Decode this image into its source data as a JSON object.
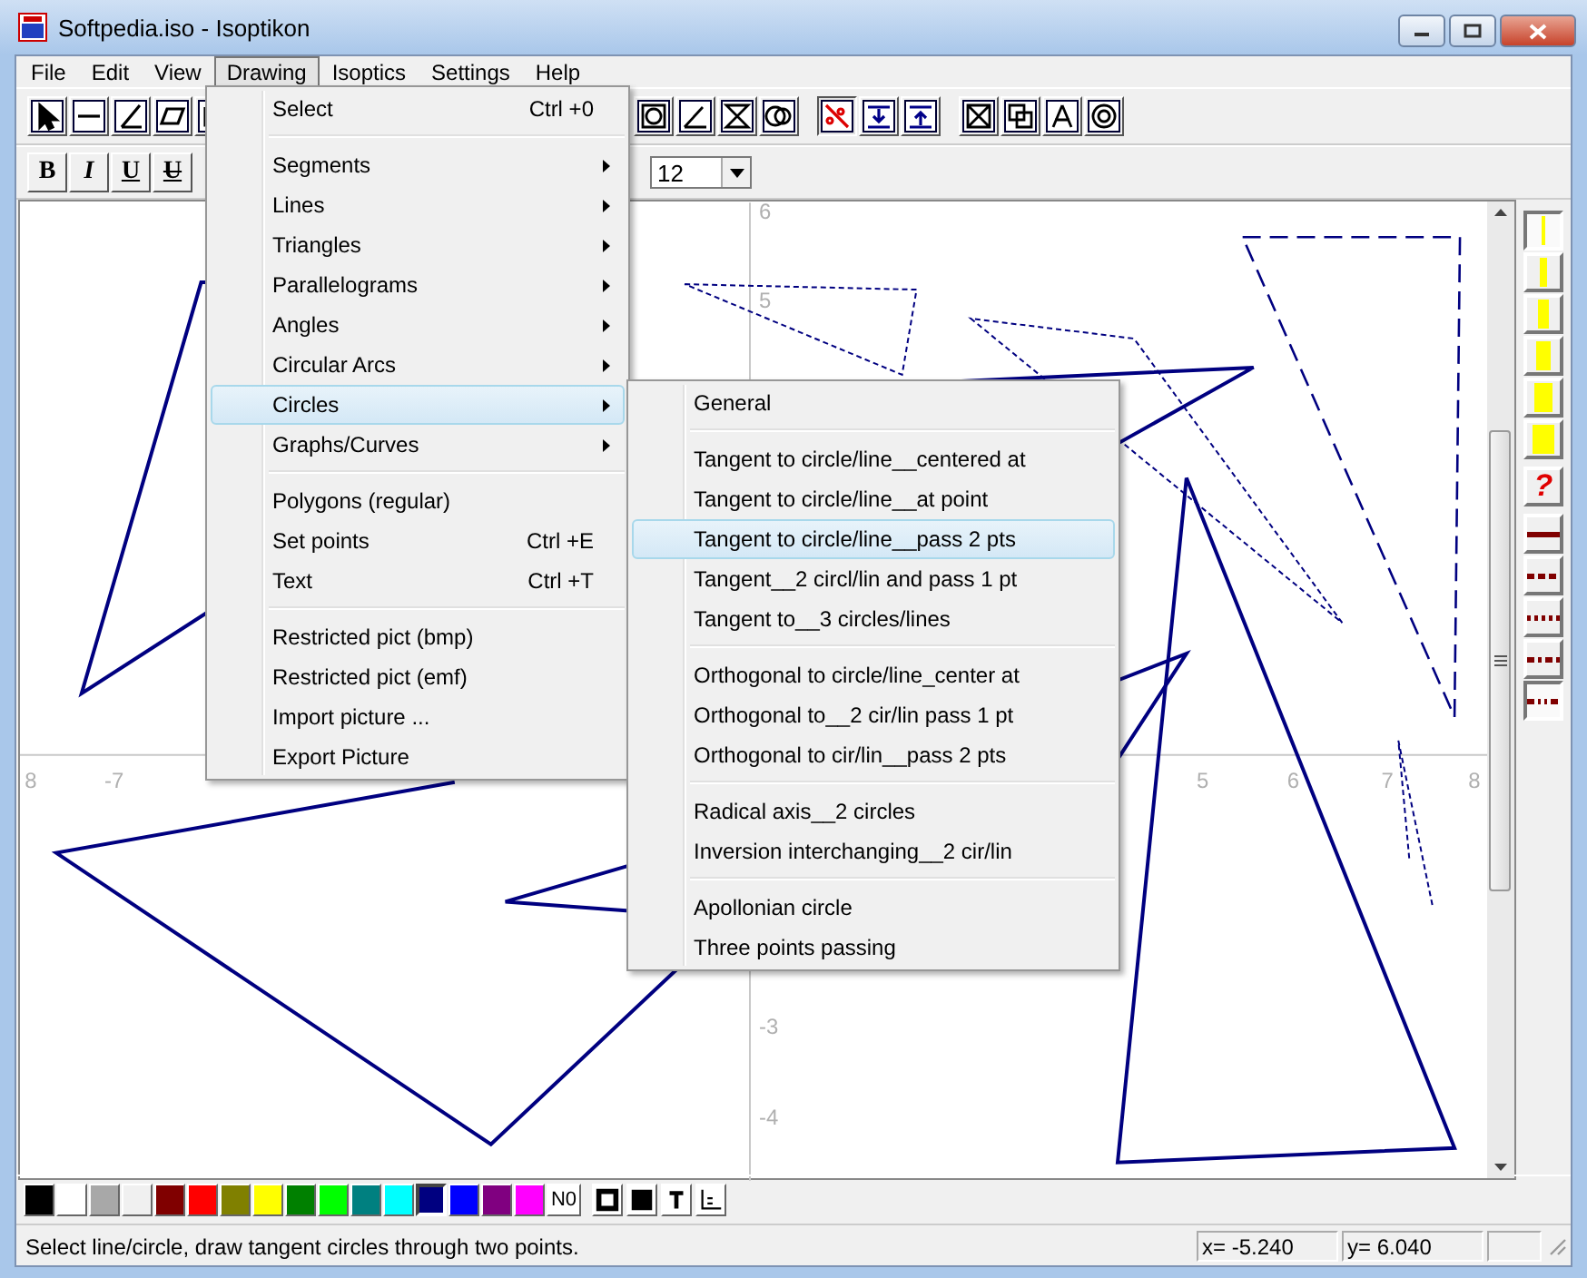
{
  "window": {
    "title": "Softpedia.iso - Isoptikon"
  },
  "menubar": [
    {
      "label": "File",
      "selected": false
    },
    {
      "label": "Edit",
      "selected": false
    },
    {
      "label": "View",
      "selected": false
    },
    {
      "label": "Drawing",
      "selected": true
    },
    {
      "label": "Isoptics",
      "selected": false
    },
    {
      "label": "Settings",
      "selected": false
    },
    {
      "label": "Help",
      "selected": false
    }
  ],
  "format_toolbar": {
    "buttons": [
      {
        "label": "B",
        "kind": "bold"
      },
      {
        "label": "I",
        "kind": "italic"
      },
      {
        "label": "U",
        "kind": "underline"
      },
      {
        "label": "U",
        "kind": "strike"
      }
    ],
    "font_size": "12"
  },
  "drawing_menu": [
    [
      {
        "label": "Select",
        "shortcut": "Ctrl +0",
        "submenu": false,
        "selected": false
      }
    ],
    [
      {
        "label": "Segments",
        "submenu": true,
        "selected": false
      },
      {
        "label": "Lines",
        "submenu": true,
        "selected": false
      },
      {
        "label": "Triangles",
        "submenu": true,
        "selected": false
      },
      {
        "label": "Parallelograms",
        "submenu": true,
        "selected": false
      },
      {
        "label": "Angles",
        "submenu": true,
        "selected": false
      },
      {
        "label": "Circular Arcs",
        "submenu": true,
        "selected": false
      },
      {
        "label": "Circles",
        "submenu": true,
        "selected": true
      },
      {
        "label": "Graphs/Curves",
        "submenu": true,
        "selected": false
      }
    ],
    [
      {
        "label": "Polygons (regular)",
        "submenu": false,
        "selected": false
      },
      {
        "label": "Set points",
        "shortcut": "Ctrl +E",
        "submenu": false,
        "selected": false
      },
      {
        "label": "Text",
        "shortcut": "Ctrl +T",
        "submenu": false,
        "selected": false
      }
    ],
    [
      {
        "label": "Restricted pict (bmp)",
        "submenu": false,
        "selected": false
      },
      {
        "label": "Restricted pict (emf)",
        "submenu": false,
        "selected": false
      },
      {
        "label": "Import picture ...",
        "submenu": false,
        "selected": false
      },
      {
        "label": "Export Picture",
        "submenu": false,
        "selected": false
      }
    ]
  ],
  "circles_submenu": [
    [
      {
        "label": "General",
        "selected": false
      }
    ],
    [
      {
        "label": "Tangent to circle/line__centered at",
        "selected": false
      },
      {
        "label": "Tangent to circle/line__at point",
        "selected": false
      },
      {
        "label": "Tangent to circle/line__pass 2 pts",
        "selected": true
      },
      {
        "label": "Tangent__2 circl/lin and pass 1 pt",
        "selected": false
      },
      {
        "label": "Tangent to__3 circles/lines",
        "selected": false
      }
    ],
    [
      {
        "label": "Orthogonal to circle/line_center at",
        "selected": false
      },
      {
        "label": "Orthogonal to__2 cir/lin pass 1 pt",
        "selected": false
      },
      {
        "label": "Orthogonal to cir/lin__pass 2 pts",
        "selected": false
      }
    ],
    [
      {
        "label": "Radical axis__2 circles",
        "selected": false
      },
      {
        "label": "Inversion interchanging__2 cir/lin",
        "selected": false
      }
    ],
    [
      {
        "label": "Apollonian circle",
        "selected": false
      },
      {
        "label": "Three points passing",
        "selected": false
      }
    ]
  ],
  "canvas": {
    "x_axis_labels": [
      "8",
      "-7",
      "5",
      "6",
      "7",
      "8"
    ],
    "y_axis_labels": [
      "6",
      "5",
      "-3",
      "-4"
    ]
  },
  "line_widths": [
    {
      "selected": true
    },
    {
      "selected": false
    },
    {
      "selected": false
    },
    {
      "selected": false
    },
    {
      "selected": false
    },
    {
      "selected": false
    }
  ],
  "help_button": "?",
  "line_styles": [
    {
      "kind": "solid",
      "selected": false
    },
    {
      "kind": "dashed",
      "selected": false
    },
    {
      "kind": "dotted",
      "selected": false
    },
    {
      "kind": "dashdot",
      "selected": false
    },
    {
      "kind": "dashdotdot",
      "selected": true
    }
  ],
  "palette": {
    "colors": [
      {
        "color": "#000000",
        "selected": false
      },
      {
        "color": "#ffffff",
        "selected": false
      },
      {
        "color": "#a8a8a8",
        "selected": false
      },
      {
        "color": "#f0f0f0",
        "selected": false
      },
      {
        "color": "#800000",
        "selected": false
      },
      {
        "color": "#ff0000",
        "selected": false
      },
      {
        "color": "#808000",
        "selected": false
      },
      {
        "color": "#ffff00",
        "selected": false
      },
      {
        "color": "#008000",
        "selected": false
      },
      {
        "color": "#00ff00",
        "selected": false
      },
      {
        "color": "#008080",
        "selected": false
      },
      {
        "color": "#00ffff",
        "selected": false
      },
      {
        "color": "#000080",
        "selected": true
      },
      {
        "color": "#0000ff",
        "selected": false
      },
      {
        "color": "#800080",
        "selected": false
      },
      {
        "color": "#ff00ff",
        "selected": false
      }
    ],
    "no_color": "N0"
  },
  "status_bar": {
    "message": "Select line/circle, draw tangent circles through two points.",
    "x": "x= -5.240",
    "y": "y= 6.040"
  }
}
